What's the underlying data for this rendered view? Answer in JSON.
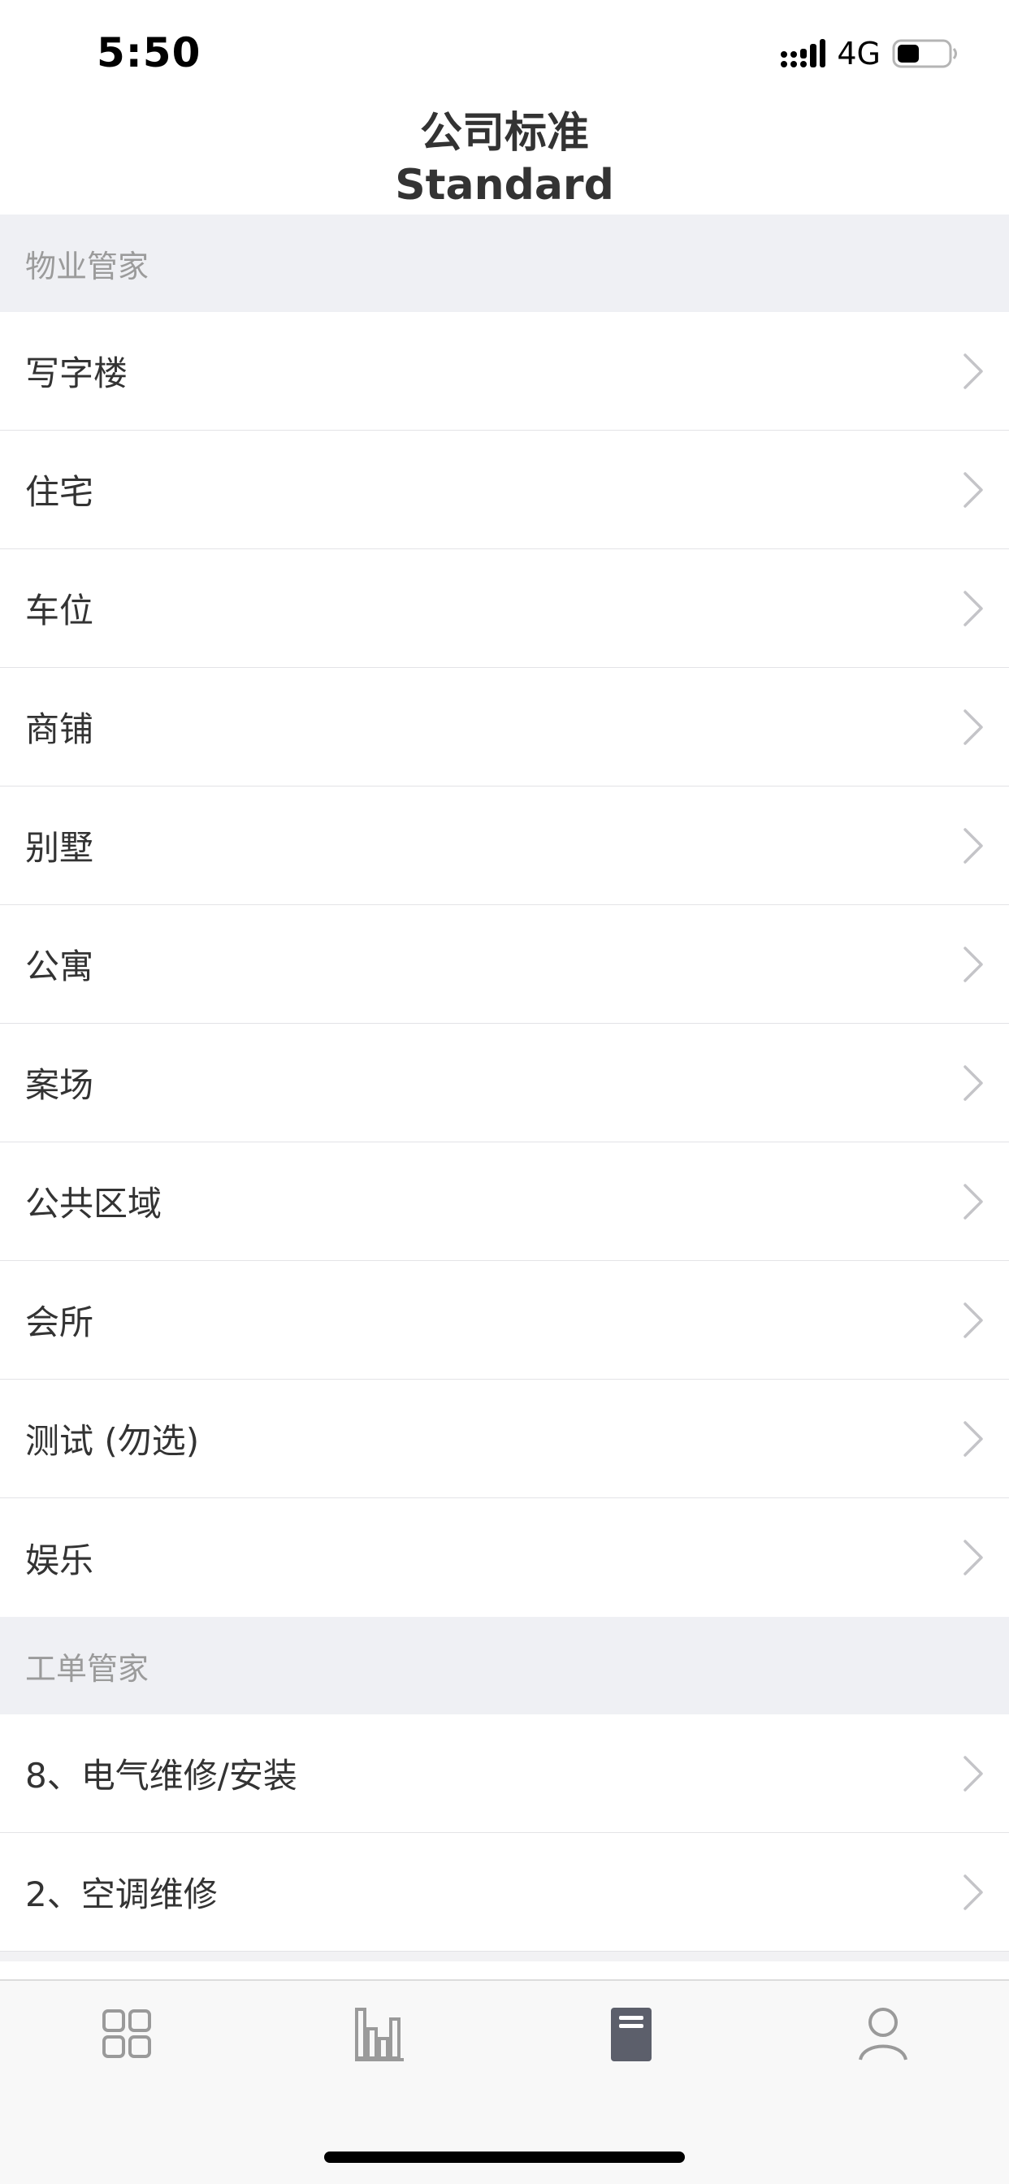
{
  "status_bar": {
    "time": "5:50",
    "network": "4G"
  },
  "header": {
    "title_cn": "公司标准",
    "title_en": "Standard"
  },
  "sections": [
    {
      "title": "物业管家",
      "items": [
        "写字楼",
        "住宅",
        "车位",
        "商铺",
        "别墅",
        "公寓",
        "案场",
        "公共区域",
        "会所",
        "测试 (勿选)",
        "娱乐"
      ]
    },
    {
      "title": "工单管家",
      "items": [
        "8、电气维修/安装",
        "2、空调维修"
      ]
    }
  ],
  "tab_bar": {
    "tabs": [
      {
        "icon": "grid-icon",
        "active": false
      },
      {
        "icon": "bar-chart-icon",
        "active": false
      },
      {
        "icon": "book-icon",
        "active": true
      },
      {
        "icon": "user-icon",
        "active": false
      }
    ]
  },
  "colors": {
    "section_bg": "#eff0f4",
    "section_text": "#9b9b9b",
    "item_text": "#333333",
    "tab_inactive": "#9a9a9a",
    "tab_active": "#5c5f6b"
  }
}
